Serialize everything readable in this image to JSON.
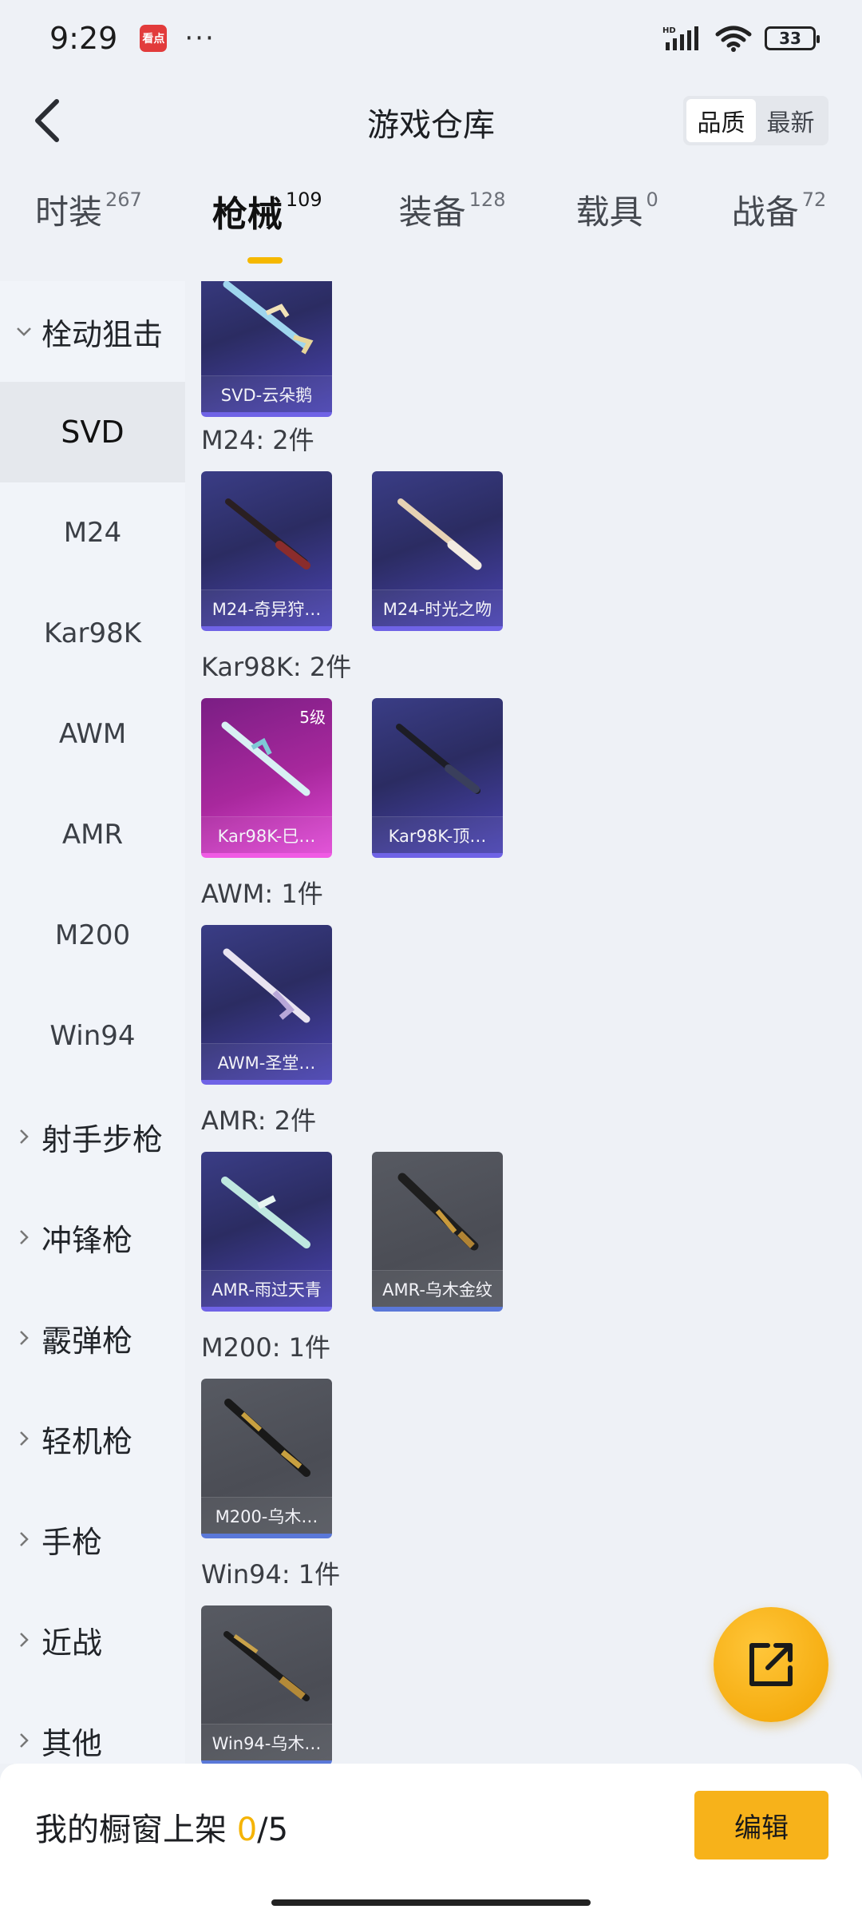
{
  "status_bar": {
    "time": "9:29",
    "app_badge": "看点",
    "more": "···",
    "network": "HD",
    "battery": "33"
  },
  "header": {
    "title": "游戏仓库",
    "sort": [
      "品质",
      "最新"
    ],
    "sort_active": "品质"
  },
  "tabs": [
    {
      "label": "时装",
      "count": "267"
    },
    {
      "label": "枪械",
      "count": "109",
      "active": true
    },
    {
      "label": "装备",
      "count": "128"
    },
    {
      "label": "载具",
      "count": "0"
    },
    {
      "label": "战备",
      "count": "72"
    }
  ],
  "sidebar": {
    "group_open": "栓动狙击",
    "sub_items": [
      "SVD",
      "M24",
      "Kar98K",
      "AWM",
      "AMR",
      "M200",
      "Win94"
    ],
    "sub_active": "SVD",
    "groups": [
      "射手步枪",
      "冲锋枪",
      "霰弹枪",
      "轻机枪",
      "手枪",
      "近战",
      "其他"
    ]
  },
  "content": {
    "top_card": {
      "name": "SVD-云朵鹅"
    },
    "sections": [
      {
        "title": "M24: 2件",
        "items": [
          {
            "name": "M24-奇异狩…",
            "rarity": "purple"
          },
          {
            "name": "M24-时光之吻",
            "rarity": "purple"
          }
        ]
      },
      {
        "title": "Kar98K: 2件",
        "items": [
          {
            "name": "Kar98K-巳…",
            "rarity": "pink",
            "level": "5级"
          },
          {
            "name": "Kar98K-顶…",
            "rarity": "purple"
          }
        ]
      },
      {
        "title": "AWM: 1件",
        "items": [
          {
            "name": "AWM-圣堂…",
            "rarity": "purple"
          }
        ]
      },
      {
        "title": "AMR: 2件",
        "items": [
          {
            "name": "AMR-雨过天青",
            "rarity": "purple"
          },
          {
            "name": "AMR-乌木金纹",
            "rarity": "gray"
          }
        ]
      },
      {
        "title": "M200: 1件",
        "items": [
          {
            "name": "M200-乌木…",
            "rarity": "gray"
          }
        ]
      },
      {
        "title": "Win94: 1件",
        "items": [
          {
            "name": "Win94-乌木…",
            "rarity": "gray"
          }
        ]
      }
    ]
  },
  "bottom": {
    "label": "我的橱窗上架 ",
    "current": "0",
    "total": "/5",
    "edit": "编辑"
  },
  "colors": {
    "accent": "#f5b800",
    "purple": "#4a43b2",
    "pink": "#e04ad6",
    "gray": "#54575f"
  }
}
